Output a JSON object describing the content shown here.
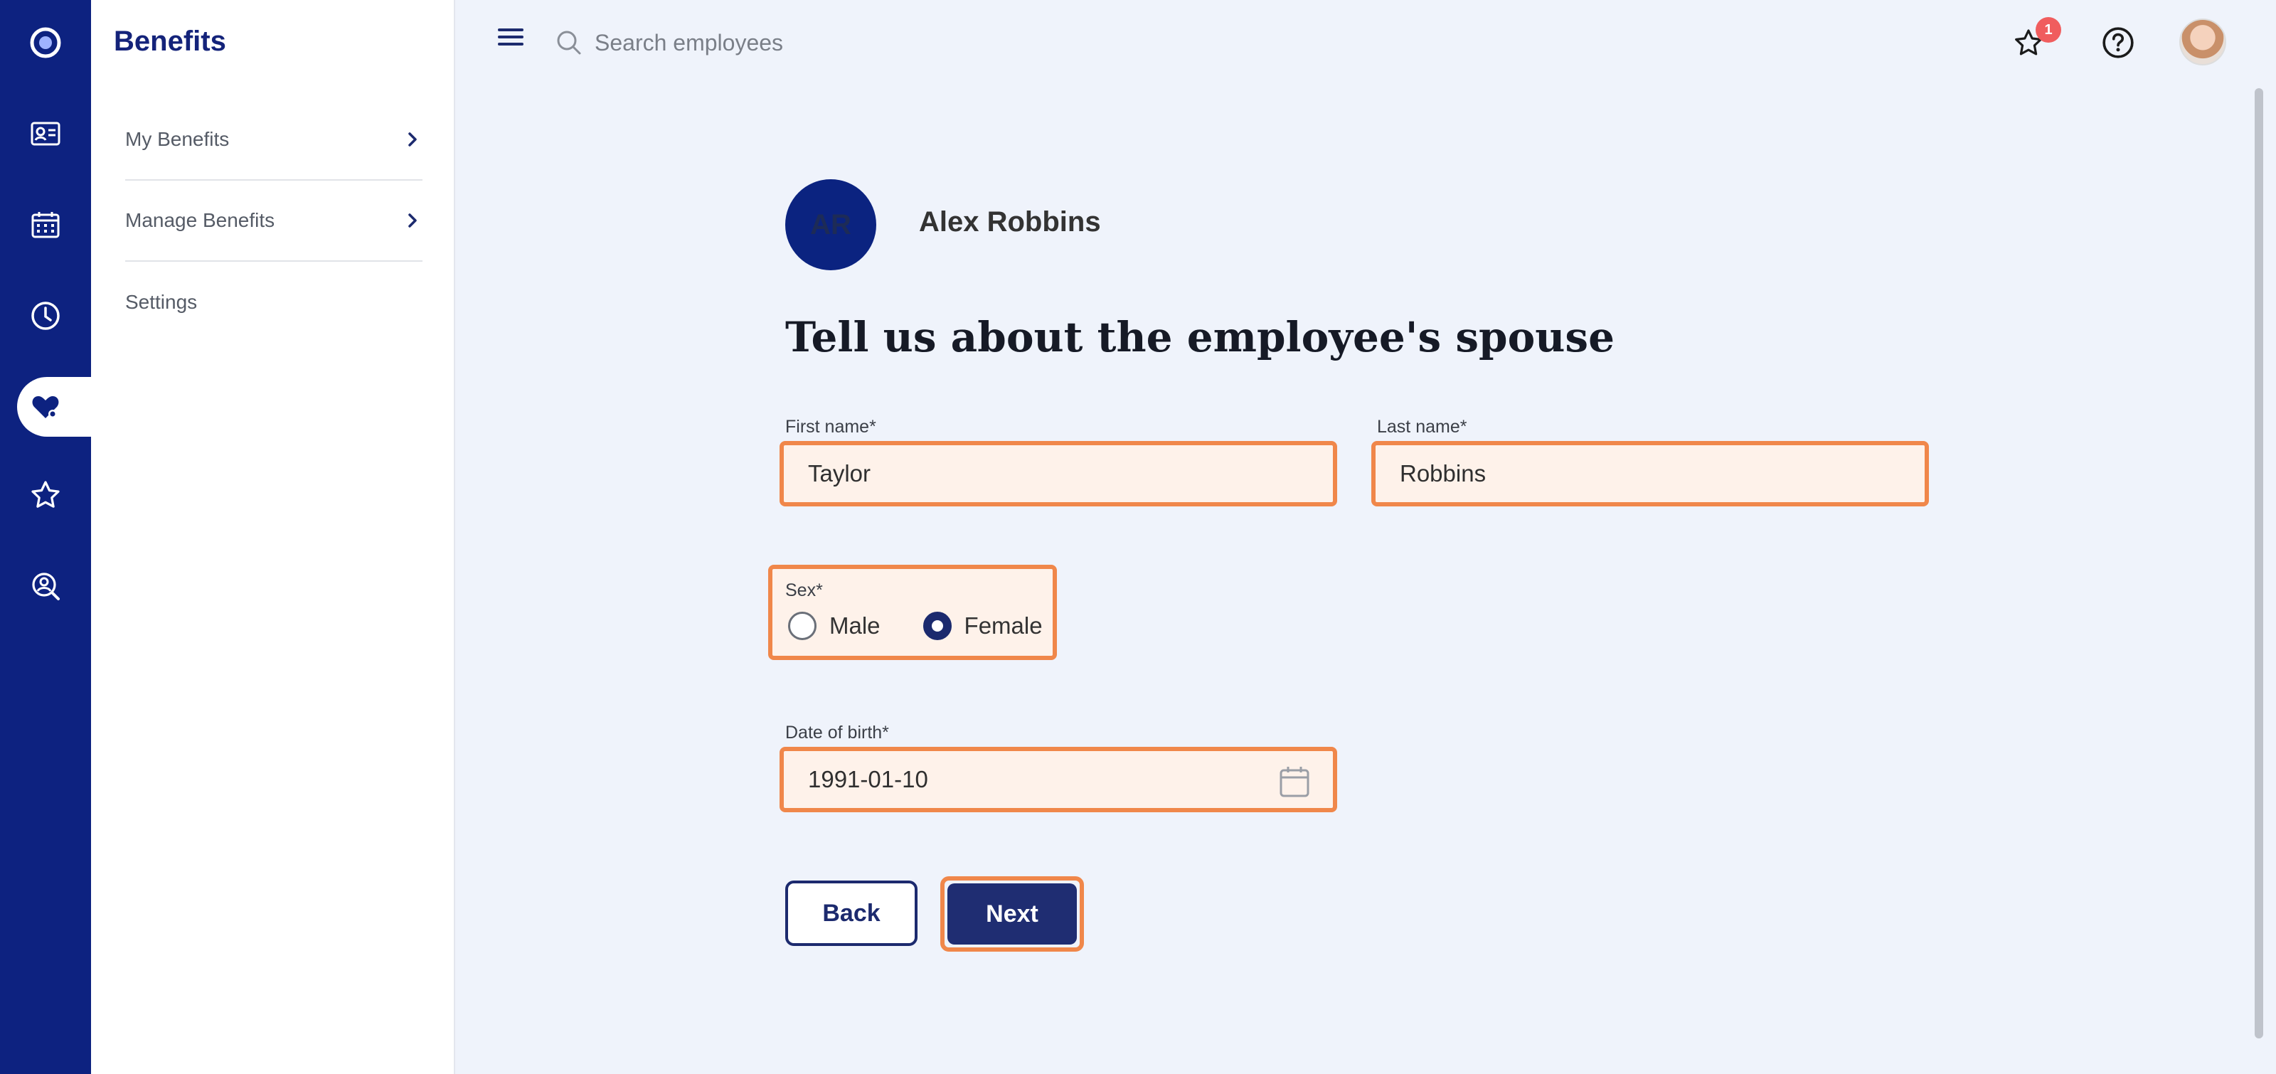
{
  "sidebar": {
    "title": "Benefits",
    "items": [
      {
        "label": "My Benefits"
      },
      {
        "label": "Manage Benefits"
      },
      {
        "label": "Settings"
      }
    ]
  },
  "rail_icons": [
    "app-logo-icon",
    "id-card-icon",
    "calendar-icon",
    "clock-icon",
    "heart-icon",
    "star-icon",
    "people-search-icon"
  ],
  "header": {
    "search_placeholder": "Search employees",
    "notifications_count": "1"
  },
  "employee": {
    "initials": "AR",
    "name": "Alex Robbins"
  },
  "form": {
    "heading": "Tell us about the employee's spouse",
    "first_name_label": "First name*",
    "first_name_value": "Taylor",
    "last_name_label": "Last name*",
    "last_name_value": "Robbins",
    "sex_label": "Sex*",
    "sex_options": [
      "Male",
      "Female"
    ],
    "sex_selected": "Female",
    "dob_label": "Date of birth*",
    "dob_value": "1991-01-10",
    "back_label": "Back",
    "next_label": "Next"
  },
  "colors": {
    "rail": "#0d2280",
    "highlight": "#f0874a",
    "primary_button": "#1f2d72",
    "badge": "#f05d5e"
  }
}
